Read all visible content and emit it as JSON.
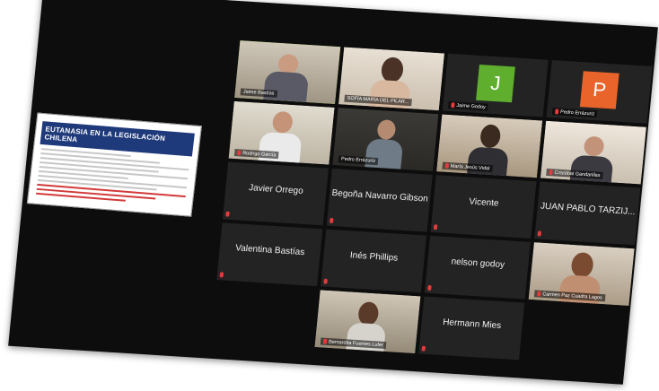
{
  "slide": {
    "title": "EUTANASIA EN LA LEGISLACIÓN CHILENA"
  },
  "colors": {
    "avatar_j": "#5fae2e",
    "avatar_p": "#e8642a",
    "muted_mic": "#e23b3b",
    "active_speaker": "#9bd12b"
  },
  "participants": [
    {
      "label": "Jaime Bastías",
      "type": "video",
      "active": true
    },
    {
      "label": "SOFÍA MARÍA DEL PILAR...",
      "type": "video"
    },
    {
      "label": "Jaime Godoy",
      "type": "avatar",
      "initial": "J"
    },
    {
      "label": "Pedro Errázuriz",
      "type": "avatar",
      "initial": "P"
    },
    {
      "label": "Rodrigo García",
      "type": "video"
    },
    {
      "label": "Pedro Errázuriz",
      "type": "video"
    },
    {
      "label": "María Jesús Vidal",
      "type": "video"
    },
    {
      "label": "Cristóbal Gandarillas",
      "type": "video"
    },
    {
      "label": "Javier Orrego",
      "type": "name"
    },
    {
      "label": "Begoña Navarro Gibson",
      "type": "name"
    },
    {
      "label": "Vicente",
      "type": "name"
    },
    {
      "label": "JUAN PABLO TARZIJ...",
      "type": "name"
    },
    {
      "label": "Valentina Bastías",
      "type": "name"
    },
    {
      "label": "Inés Phillips",
      "type": "name"
    },
    {
      "label": "nelson godoy",
      "type": "name"
    },
    {
      "label": "Carmen Paz Cuadra Lagos",
      "type": "video"
    },
    {
      "label": "Bernardita Fuentes Lufer",
      "type": "video"
    },
    {
      "label": "Hermann Mies",
      "type": "name"
    }
  ]
}
